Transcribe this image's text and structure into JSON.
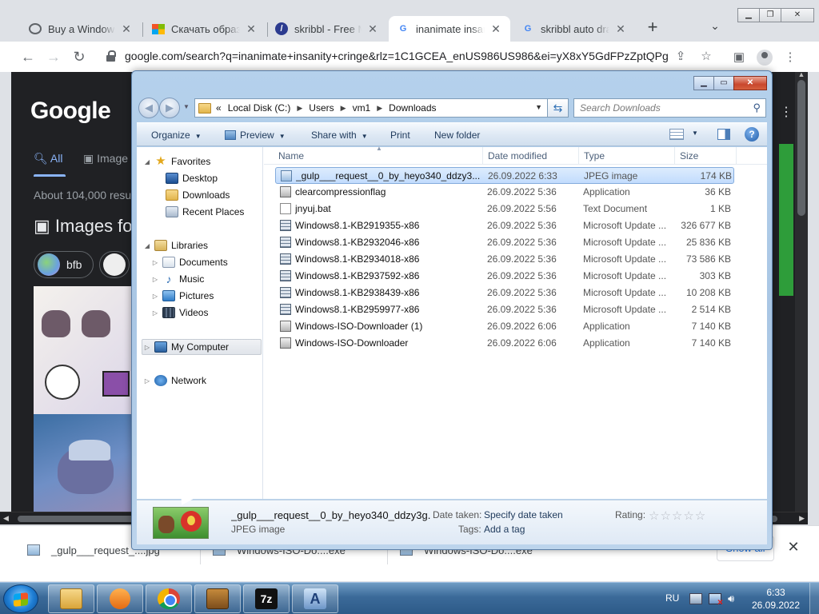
{
  "browser": {
    "tabs": [
      {
        "label": "Buy a Windows 7",
        "favicon": "globe-icon"
      },
      {
        "label": "Скачать образ диска",
        "favicon": "windows-icon"
      },
      {
        "label": "skribbl - Free Multiplayer",
        "favicon": "skribbl-icon"
      },
      {
        "label": "inanimate insanity",
        "favicon": "google-icon",
        "active": true
      },
      {
        "label": "skribbl auto draw",
        "favicon": "google-icon"
      }
    ],
    "url": "google.com/search?q=inanimate+insanity+cringe&rlz=1C1GCEA_enUS986US986&ei=yX8xY5GdFPzZptQPg..."
  },
  "google": {
    "logo": "Google",
    "tab_all": "All",
    "tab_images": "Image",
    "about": "About 104,000 resu",
    "images_title": "Images fo",
    "chip1": "bfb"
  },
  "downloads_shelf": {
    "items": [
      "_gulp___request_....jpg",
      "Windows-ISO-Do....exe",
      "Windows-ISO-Do....exe"
    ],
    "show_all": "Show all"
  },
  "explorer": {
    "breadcrumb": [
      "Local Disk (C:)",
      "Users",
      "vm1",
      "Downloads"
    ],
    "breadcrumb_prefix": "«",
    "search_placeholder": "Search Downloads",
    "commands": {
      "organize": "Organize",
      "preview": "Preview",
      "share_with": "Share with",
      "print": "Print",
      "new_folder": "New folder"
    },
    "nav": {
      "favorites": "Favorites",
      "desktop": "Desktop",
      "downloads": "Downloads",
      "recent": "Recent Places",
      "libraries": "Libraries",
      "documents": "Documents",
      "music": "Music",
      "pictures": "Pictures",
      "videos": "Videos",
      "my_computer": "My Computer",
      "network": "Network"
    },
    "columns": {
      "name": "Name",
      "date": "Date modified",
      "type": "Type",
      "size": "Size"
    },
    "files": [
      {
        "name": "_gulp___request__0_by_heyo340_ddzy3...",
        "date": "26.09.2022 6:33",
        "type": "JPEG image",
        "size": "174 KB",
        "icon": "jpg",
        "selected": true
      },
      {
        "name": "clearcompressionflag",
        "date": "26.09.2022 5:36",
        "type": "Application",
        "size": "36 KB",
        "icon": "app"
      },
      {
        "name": "jnyuj.bat",
        "date": "26.09.2022 5:56",
        "type": "Text Document",
        "size": "1 KB",
        "icon": "txt"
      },
      {
        "name": "Windows8.1-KB2919355-x86",
        "date": "26.09.2022 5:36",
        "type": "Microsoft Update ...",
        "size": "326 677 KB",
        "icon": "msu"
      },
      {
        "name": "Windows8.1-KB2932046-x86",
        "date": "26.09.2022 5:36",
        "type": "Microsoft Update ...",
        "size": "25 836 KB",
        "icon": "msu"
      },
      {
        "name": "Windows8.1-KB2934018-x86",
        "date": "26.09.2022 5:36",
        "type": "Microsoft Update ...",
        "size": "73 586 KB",
        "icon": "msu"
      },
      {
        "name": "Windows8.1-KB2937592-x86",
        "date": "26.09.2022 5:36",
        "type": "Microsoft Update ...",
        "size": "303 KB",
        "icon": "msu"
      },
      {
        "name": "Windows8.1-KB2938439-x86",
        "date": "26.09.2022 5:36",
        "type": "Microsoft Update ...",
        "size": "10 208 KB",
        "icon": "msu"
      },
      {
        "name": "Windows8.1-KB2959977-x86",
        "date": "26.09.2022 5:36",
        "type": "Microsoft Update ...",
        "size": "2 514 KB",
        "icon": "msu"
      },
      {
        "name": "Windows-ISO-Downloader (1)",
        "date": "26.09.2022 6:06",
        "type": "Application",
        "size": "7 140 KB",
        "icon": "app"
      },
      {
        "name": "Windows-ISO-Downloader",
        "date": "26.09.2022 6:06",
        "type": "Application",
        "size": "7 140 KB",
        "icon": "app"
      }
    ],
    "details": {
      "name": "_gulp___request__0_by_heyo340_ddzy3g...",
      "type": "JPEG image",
      "date_taken_label": "Date taken:",
      "date_taken_value": "Specify date taken",
      "tags_label": "Tags:",
      "tags_value": "Add a tag",
      "rating_label": "Rating:",
      "rating_stars": "☆☆☆☆☆"
    }
  },
  "taskbar": {
    "lang": "RU",
    "time": "6:33",
    "date": "26.09.2022",
    "icons": [
      "explorer-icon",
      "media-player-icon",
      "chrome-icon",
      "archive-icon",
      "7zip-icon",
      "app-a-icon"
    ]
  }
}
